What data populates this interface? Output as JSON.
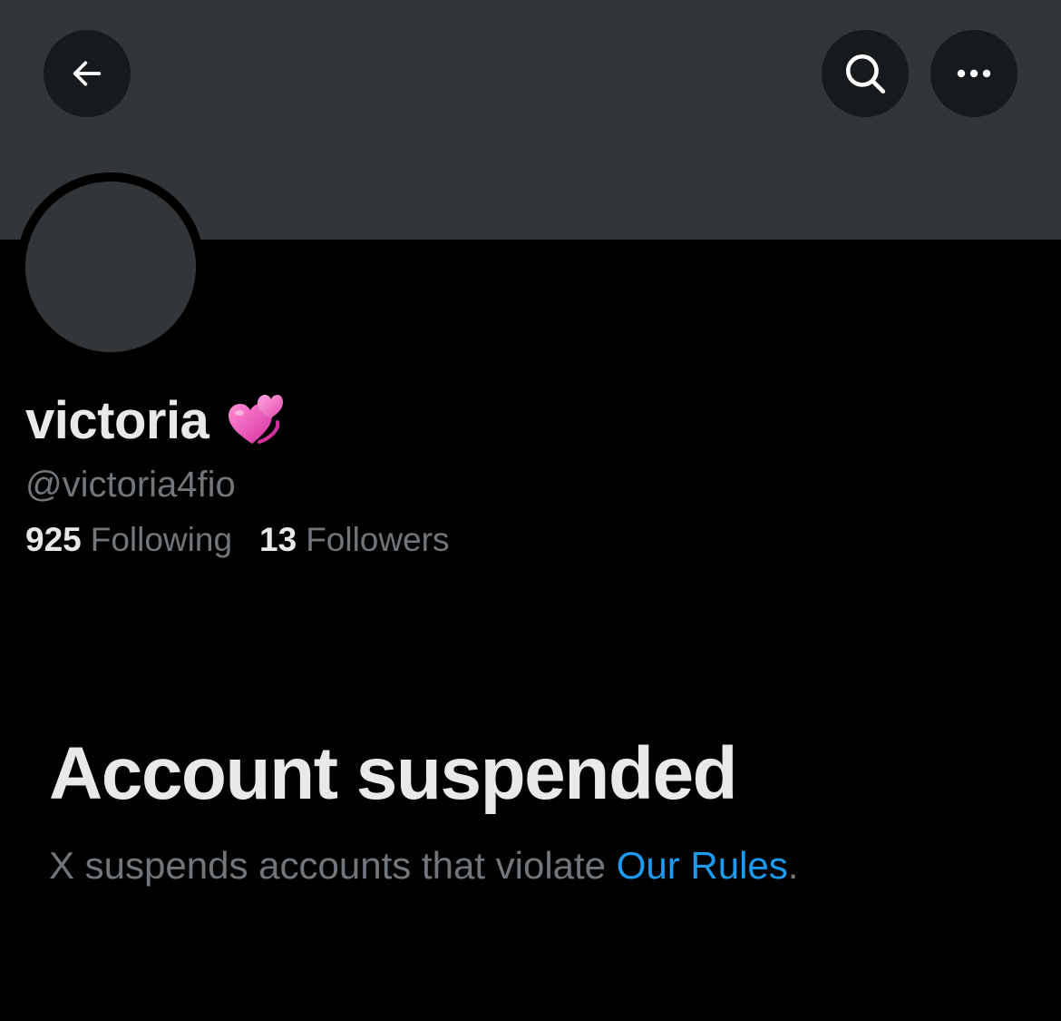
{
  "header": {
    "back_icon": "arrow-left-icon",
    "search_icon": "search-icon",
    "more_icon": "more-horizontal-icon"
  },
  "profile": {
    "display_name": "victoria",
    "name_emoji": "revolving-hearts",
    "handle": "@victoria4fio",
    "following_count": "925",
    "following_label": "Following",
    "followers_count": "13",
    "followers_label": "Followers"
  },
  "notice": {
    "title": "Account suspended",
    "description": "X suspends accounts that violate ",
    "link_text": "Our Rules",
    "trailing": "."
  },
  "colors": {
    "background": "#000000",
    "banner": "#333639",
    "primary_text": "#e7e9ea",
    "secondary_text": "#71767b",
    "link": "#1d9bf0"
  }
}
